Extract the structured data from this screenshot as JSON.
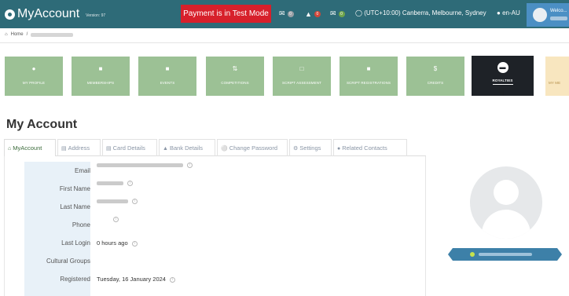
{
  "header": {
    "app_title": "MyAccount",
    "version": "Version: 97",
    "payment_notice": "Payment is in Test Mode",
    "notifications": [
      {
        "icon": "message-icon",
        "count": "0",
        "color": "#9aa0a6"
      },
      {
        "icon": "bell-icon",
        "count": "0",
        "color": "#d0473a"
      },
      {
        "icon": "mail-icon",
        "count": "0",
        "color": "#6ea34b"
      }
    ],
    "timezone": "(UTC+10:00) Canberra, Melbourne, Sydney",
    "locale": "en-AU",
    "welcome": "Welco..."
  },
  "breadcrumb": {
    "home": "Home",
    "separator": "/"
  },
  "tiles": [
    {
      "label": "MY PROFILE",
      "icon": "user-icon"
    },
    {
      "label": "MEMBERSHIPS",
      "icon": "badge-icon"
    },
    {
      "label": "EVENTS",
      "icon": "calendar-icon"
    },
    {
      "label": "COMPETITIONS",
      "icon": "trophy-icon"
    },
    {
      "label": "SCRIPT ASSESSMENT",
      "icon": "document-icon"
    },
    {
      "label": "SCRIPT REGISTRATIONS",
      "icon": "document-icon"
    },
    {
      "label": "CREDITS",
      "icon": "dollar-icon"
    },
    {
      "label": "ROYALTIES",
      "icon": "money-icon"
    },
    {
      "label": "MY ME",
      "icon": "user-icon"
    }
  ],
  "page_title": "My Account",
  "tabs": [
    {
      "label": "MyAccount",
      "icon": "home-icon",
      "active": true
    },
    {
      "label": "Address",
      "icon": "address-icon",
      "active": false
    },
    {
      "label": "Card Details",
      "icon": "card-icon",
      "active": false
    },
    {
      "label": "Bank Details",
      "icon": "bank-icon",
      "active": false
    },
    {
      "label": "Change Password",
      "icon": "key-icon",
      "active": false
    },
    {
      "label": "Settings",
      "icon": "gear-icon",
      "active": false
    },
    {
      "label": "Related Contacts",
      "icon": "contacts-icon",
      "active": false
    }
  ],
  "fields": [
    {
      "label": "Email",
      "value": ""
    },
    {
      "label": "First Name",
      "value": ""
    },
    {
      "label": "Last Name",
      "value": ""
    },
    {
      "label": "Phone",
      "value": ""
    },
    {
      "label": "Last Login",
      "value": "0 hours ago"
    },
    {
      "label": "Cultural Groups",
      "value": ""
    },
    {
      "label": "Registered",
      "value": "Tuesday, 16 January 2024"
    }
  ],
  "colors": {
    "topbar": "#2e6b78",
    "alert": "#d7202b",
    "tile": "#9cc195",
    "tile_active": "#1e2227",
    "ribbon": "#3d80a8"
  }
}
